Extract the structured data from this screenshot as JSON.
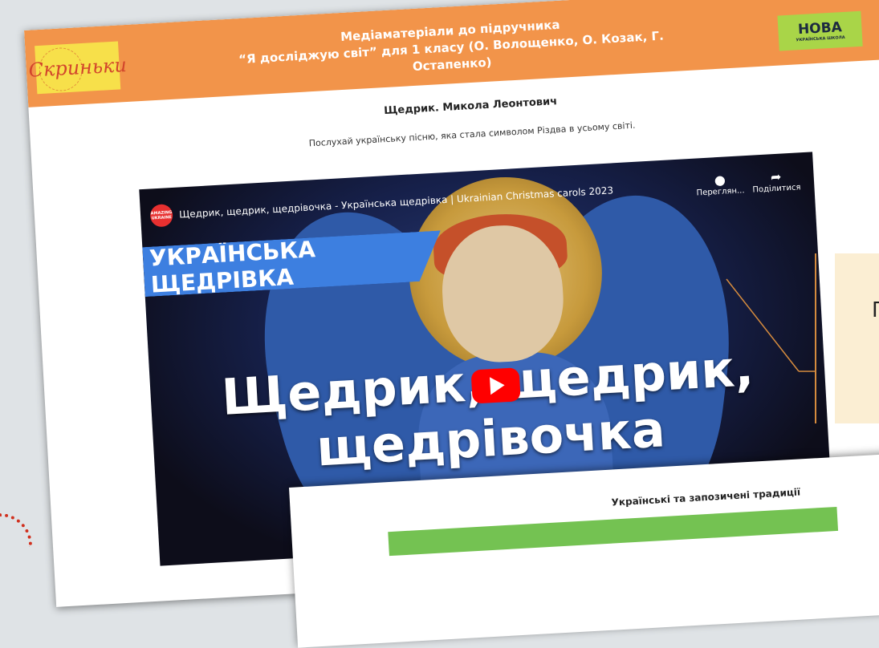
{
  "header": {
    "logo_text": "Скриньки",
    "line1": "Медіаматеріали до підручника",
    "line2": "“Я досліджую світ” для 1 класу (О. Волощенко, О. Козак, Г. Остапенко)",
    "publisher_logo": "НОВА",
    "publisher_sub": "УКРАЇНСЬКА ШКОЛА"
  },
  "article": {
    "title": "Щедрик. Микола Леонтович",
    "description": "Послухай українську пісню, яка стала символом Різдва в усьому світі."
  },
  "video": {
    "channel_badge": "AMAZING UKRAINE",
    "title": "Щедрик, щедрик, щедрівочка - Українська щедрівка | Ukrainian Christmas carols 2023",
    "watch_later_label": "Переглян...",
    "share_label": "Поділитися",
    "banner_text": "УКРАЇНСЬКА ЩЕДРІВКА",
    "big_title_line1": "Щедрик, щедрик,",
    "big_title_line2": "щедрівочка"
  },
  "callout": {
    "text": "П"
  },
  "second_page": {
    "title": "Українські та запозичені традиції"
  },
  "colors": {
    "header": "#f2944a",
    "logo_yellow": "#f7e04a",
    "nova_green": "#a9d548",
    "banner_blue": "#3d7fe0",
    "play_red": "#ff0000",
    "callout_bg": "#fbeed3",
    "second_bar": "#74c252"
  }
}
